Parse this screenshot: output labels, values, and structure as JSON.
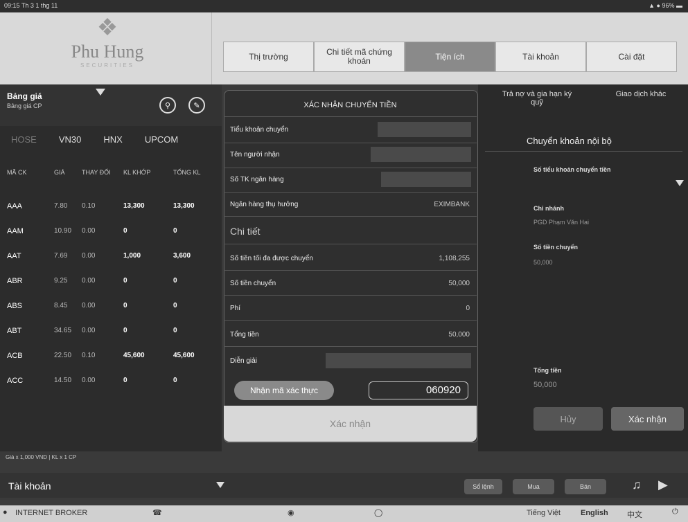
{
  "status_bar": {
    "time": "09:15  Th 3 1 thg 11",
    "battery": "▲ ● 96% ▬"
  },
  "brand": {
    "name": "Phu Hung",
    "subtitle": "SECURITIES"
  },
  "main_tabs": [
    {
      "label": "Thị trường"
    },
    {
      "label": "Chi tiết mã chứng khoán"
    },
    {
      "label": "Tiện ích"
    },
    {
      "label": "Tài khoản"
    },
    {
      "label": "Cài đặt"
    }
  ],
  "price_board": {
    "title": "Bảng giá",
    "subtitle": "Bảng giá CP",
    "markets": [
      "HOSE",
      "VN30",
      "HNX",
      "UPCOM"
    ],
    "columns": [
      "MÃ CK",
      "GIÁ",
      "THAY ĐỔI",
      "KL KHỚP",
      "TỔNG KL"
    ],
    "rows": [
      {
        "code": "AAA",
        "price": "7.80",
        "change": "0.10",
        "vol": "13,300",
        "total": "13,300"
      },
      {
        "code": "AAM",
        "price": "10.90",
        "change": "0.00",
        "vol": "0",
        "total": "0"
      },
      {
        "code": "AAT",
        "price": "7.69",
        "change": "0.00",
        "vol": "1,000",
        "total": "3,600"
      },
      {
        "code": "ABR",
        "price": "9.25",
        "change": "0.00",
        "vol": "0",
        "total": "0"
      },
      {
        "code": "ABS",
        "price": "8.45",
        "change": "0.00",
        "vol": "0",
        "total": "0"
      },
      {
        "code": "ABT",
        "price": "34.65",
        "change": "0.00",
        "vol": "0",
        "total": "0"
      },
      {
        "code": "ACB",
        "price": "22.50",
        "change": "0.10",
        "vol": "45,600",
        "total": "45,600"
      },
      {
        "code": "ACC",
        "price": "14.50",
        "change": "0.00",
        "vol": "0",
        "total": "0"
      }
    ],
    "footnote": "Giá x 1,000 VND | KL x 1 CP"
  },
  "right_panel": {
    "top_links": [
      "Trả nợ và gia hạn ký quỹ",
      "Giao dịch khác"
    ],
    "title": "Chuyển khoản nội bộ",
    "field_account": "Số tiểu khoản chuyển tiền",
    "field_branch": "Chi nhánh",
    "branch_value": "PGD Phạm Văn Hai",
    "field_amount": "Số tiền chuyển",
    "amount_value": "50,000",
    "field_total": "Tổng tiền",
    "total_value": "50,000",
    "cancel": "Hủy",
    "confirm": "Xác nhận"
  },
  "modal": {
    "title": "XÁC NHẬN CHUYỂN TIỀN",
    "from_account": "Tiểu khoản chuyển",
    "recipient": "Tên người nhận",
    "bank_account": "Số TK ngân hàng",
    "bank": "Ngân hàng thụ hưởng",
    "bank_value": "EXIMBANK",
    "detail": "Chi tiết",
    "max_amount": "Số tiền tối đa được chuyển",
    "max_amount_value": "1,108,255",
    "amount": "Số tiền chuyển",
    "amount_value": "50,000",
    "fee": "Phí",
    "fee_value": "0",
    "total": "Tổng tiền",
    "total_value": "50,000",
    "description": "Diễn giải",
    "otp_button": "Nhận mã xác thực",
    "otp_value": "060920",
    "confirm": "Xác nhận"
  },
  "bottom": {
    "account": "Tài khoản",
    "orders": "Sổ lệnh",
    "buy": "Mua",
    "sell": "Bán",
    "broker": "INTERNET BROKER",
    "langs": [
      "Tiếng Việt",
      "English",
      "中文"
    ]
  }
}
